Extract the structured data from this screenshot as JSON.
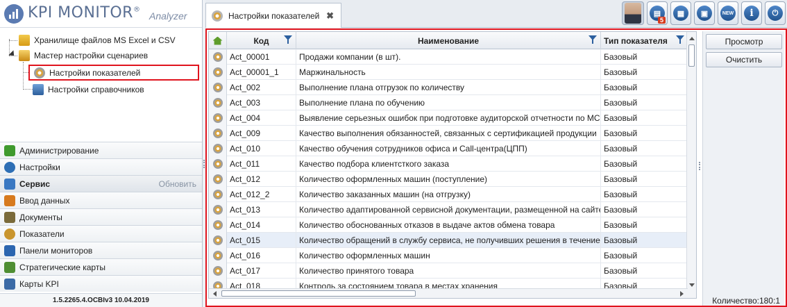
{
  "app": {
    "logo_text": "KPI MONITOR",
    "logo_reg": "®",
    "logo_sub": "Analyzer",
    "version": "1.5.2265.4.OCBIv3  10.04.2019"
  },
  "tree": {
    "items": [
      {
        "label": "Хранилище файлов MS Excel и CSV",
        "icon": "folder-icon"
      },
      {
        "label": "Мастер настройки сценариев",
        "icon": "wizard-icon"
      },
      {
        "label": "Настройки показателей",
        "icon": "indicator-settings-icon",
        "selected": true
      },
      {
        "label": "Настройки справочников",
        "icon": "dictionary-settings-icon"
      }
    ]
  },
  "nav": {
    "refresh_label": "Обновить",
    "items": [
      {
        "label": "Администрирование",
        "icon": "admin-icon",
        "color": "#3f9a2e"
      },
      {
        "label": "Настройки",
        "icon": "settings-icon",
        "color": "#2e6fb5"
      },
      {
        "label": "Сервис",
        "icon": "tools-icon",
        "color": "#3a78c2",
        "active": true
      },
      {
        "label": "Ввод данных",
        "icon": "data-input-icon",
        "color": "#d77a1e"
      },
      {
        "label": "Документы",
        "icon": "documents-icon",
        "color": "#7a6a3a"
      },
      {
        "label": "Показатели",
        "icon": "indicators-icon",
        "color": "#c9952e"
      },
      {
        "label": "Панели мониторов",
        "icon": "dashboards-icon",
        "color": "#2c66b0"
      },
      {
        "label": "Стратегические карты",
        "icon": "strategy-map-icon",
        "color": "#4f8e33"
      },
      {
        "label": "Карты KPI",
        "icon": "kpi-map-icon",
        "color": "#3b6aa6"
      }
    ]
  },
  "tab": {
    "label": "Настройки показателей",
    "close": "✖"
  },
  "toolbar": {
    "badge": "5",
    "buttons": [
      {
        "name": "user-avatar-button",
        "glyph": ""
      },
      {
        "name": "notifications-button",
        "glyph": "▤"
      },
      {
        "name": "grid-button",
        "glyph": "▦"
      },
      {
        "name": "report-button",
        "glyph": "▣"
      },
      {
        "name": "new-button",
        "glyph": "NEW"
      },
      {
        "name": "info-button",
        "glyph": "i"
      },
      {
        "name": "power-button",
        "glyph": "⏻"
      }
    ]
  },
  "grid": {
    "columns": [
      "Код",
      "Наименование",
      "Тип показателя"
    ],
    "rows": [
      {
        "code": "Act_00001",
        "name": "Продажи компании (в шт).",
        "type": "Базовый"
      },
      {
        "code": "Act_00001_1",
        "name": "Маржинальность",
        "type": "Базовый"
      },
      {
        "code": "Act_002",
        "name": "Выполнение плана отгрузок по количеству",
        "type": "Базовый"
      },
      {
        "code": "Act_003",
        "name": "Выполнение плана по обучению",
        "type": "Базовый"
      },
      {
        "code": "Act_004",
        "name": "Выявление серьезных ошибок при подготовке аудиторской отчетности по МСФО",
        "type": "Базовый"
      },
      {
        "code": "Act_009",
        "name": "Качество выполнения обязанностей, связанных с сертификацией продукции",
        "type": "Базовый"
      },
      {
        "code": "Act_010",
        "name": "Качество обучения сотрудников офиса и Call-центра(ЦПП)",
        "type": "Базовый"
      },
      {
        "code": "Act_011",
        "name": "Качество подбора клиентсткого заказа",
        "type": "Базовый"
      },
      {
        "code": "Act_012",
        "name": "Количество оформленных машин (поступление)",
        "type": "Базовый"
      },
      {
        "code": "Act_012_2",
        "name": "Количество заказанных машин (на отгрузку)",
        "type": "Базовый"
      },
      {
        "code": "Act_013",
        "name": "Количество адаптированной сервисной документации, размещенной на сайте",
        "type": "Базовый"
      },
      {
        "code": "Act_014",
        "name": "Количество обоснованных отказов в выдаче актов обмена товара",
        "type": "Базовый"
      },
      {
        "code": "Act_015",
        "name": "Количество обращений в службу сервиса, не получивших решения в течение",
        "type": "Базовый",
        "selected": true
      },
      {
        "code": "Act_016",
        "name": "Количество оформленных машин",
        "type": "Базовый"
      },
      {
        "code": "Act_017",
        "name": "Количество принятого товара",
        "type": "Базовый"
      },
      {
        "code": "Act_018",
        "name": "Контроль за состоянием товара в местах хранения",
        "type": "Базовый"
      }
    ]
  },
  "side": {
    "view_button": "Просмотр",
    "clear_button": "Очистить",
    "count_label": "Количество:180:1"
  }
}
